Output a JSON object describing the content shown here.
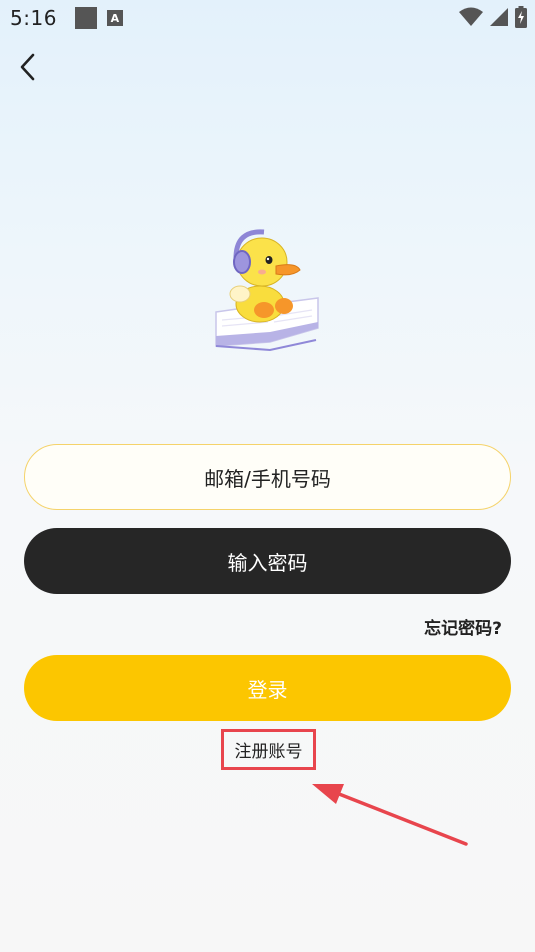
{
  "status_bar": {
    "time": "5:16",
    "notification_icon_letter": "A",
    "icons": [
      "stop-square-icon",
      "a-notification-icon",
      "wifi-icon",
      "cellular-signal-icon",
      "battery-charging-icon"
    ]
  },
  "navigation": {
    "back_icon": "chevron-left-icon"
  },
  "mascot": {
    "icon": "duck-with-headphones-on-book"
  },
  "form": {
    "email_placeholder": "邮箱/手机号码",
    "password_placeholder": "输入密码",
    "forgot_password_label": "忘记密码?",
    "login_label": "登录",
    "register_label": "注册账号"
  },
  "annotation": {
    "highlight_color": "#e8454d",
    "arrow_icon": "red-arrow-pointing-to-register"
  },
  "colors": {
    "accent": "#fcc600",
    "dark_field": "#262626",
    "email_border": "#f5d36a"
  }
}
